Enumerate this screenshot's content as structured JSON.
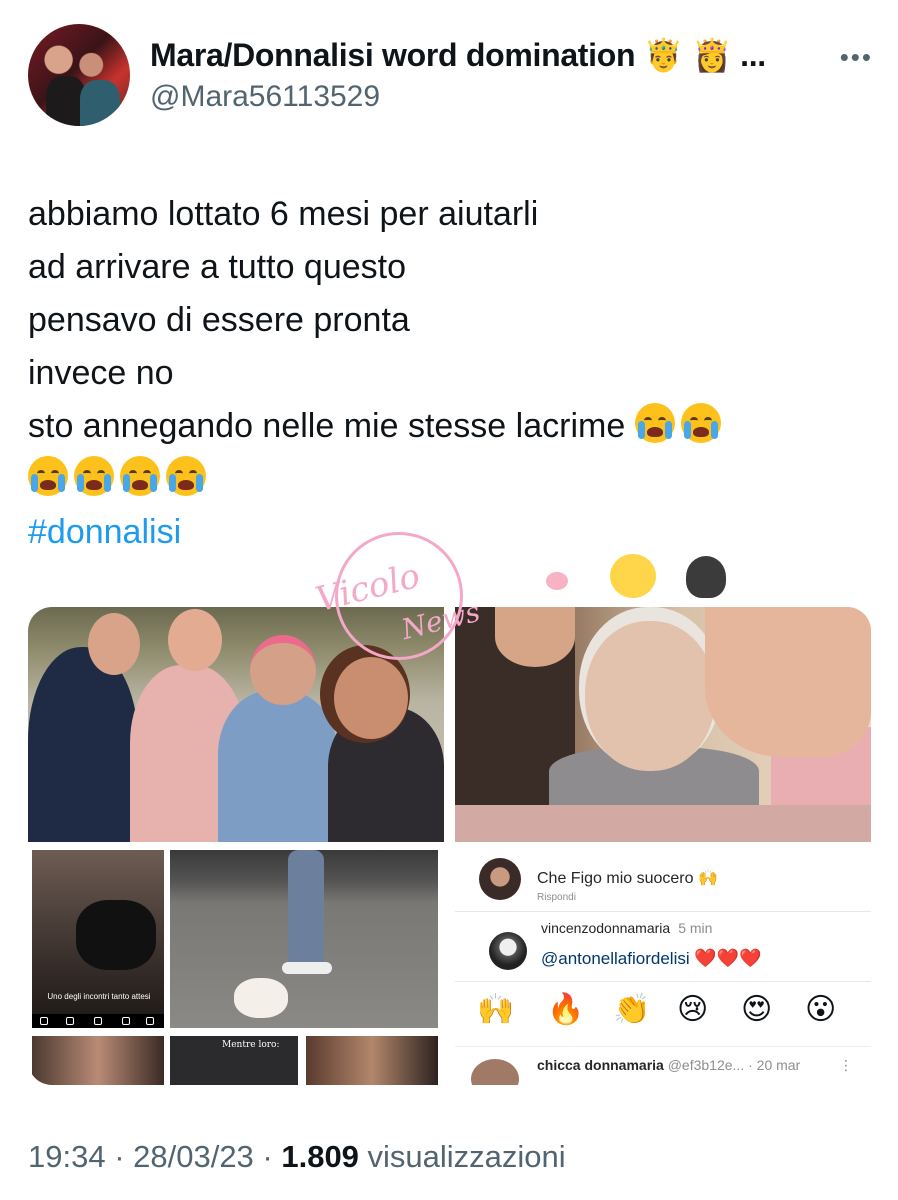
{
  "user": {
    "display_name": "Mara/Donnalisi word domination 🤴 👸 ...",
    "handle": "@Mara56113529"
  },
  "more_label": "•••",
  "tweet": {
    "lines": [
      "abbiamo lottato 6 mesi per aiutarli",
      "ad arrivare a tutto questo",
      "pensavo di essere pronta",
      "invece no",
      "sto annegando nelle mie stesse lacrime"
    ],
    "emoji_name": "loudly-crying-face-icon",
    "hashtag": "#donnalisi"
  },
  "watermark": {
    "line1": "Vicolo",
    "line2": "News"
  },
  "embedded": {
    "caption": "Uno degli incontri tanto attesi",
    "label_mentre_loro": "Mentre loro:",
    "comment1": "Che Figo mio suocero 🙌",
    "comment1_sub": "Rispondi",
    "comment2_user": "vincenzodonnamaria",
    "comment2_time": "5 min",
    "comment2_mention": "@antonellafiordelisi",
    "comment2_hearts": "❤️❤️❤️",
    "reactions": [
      "🙌",
      "🔥",
      "👏",
      "😢",
      "😍",
      "😮"
    ],
    "comment3_user": "chicca donnamaria",
    "comment3_handle": "@ef3b12e...",
    "comment3_date": "· 20 mar"
  },
  "footer": {
    "time": "19:34 · 28/03/23 · ",
    "views": "1.809",
    "views_label": " visualizzazioni"
  }
}
